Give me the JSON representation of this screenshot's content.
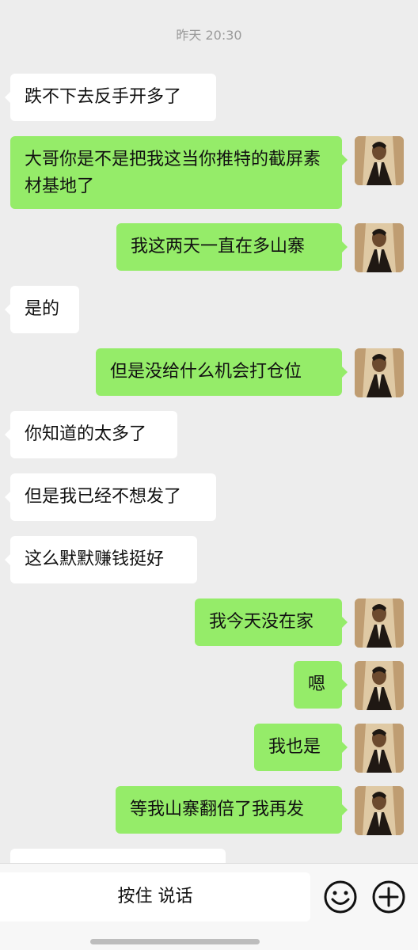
{
  "chat": {
    "timestamp": "昨天 20:30",
    "messages": [
      {
        "side": "left",
        "text": "跌不下去反手开多了"
      },
      {
        "side": "right",
        "text": "大哥你是不是把我这当你推特的截屏素材基地了"
      },
      {
        "side": "right",
        "text": "我这两天一直在多山寨"
      },
      {
        "side": "left",
        "text": "是的"
      },
      {
        "side": "right",
        "text": "但是没给什么机会打仓位"
      },
      {
        "side": "left",
        "text": "你知道的太多了"
      },
      {
        "side": "left",
        "text": "但是我已经不想发了"
      },
      {
        "side": "left",
        "text": "这么默默赚钱挺好"
      },
      {
        "side": "right",
        "text": "我今天没在家"
      },
      {
        "side": "right",
        "text": "嗯"
      },
      {
        "side": "right",
        "text": "我也是"
      },
      {
        "side": "right",
        "text": "等我山寨翻倍了我再发"
      }
    ]
  },
  "input_bar": {
    "voice_label": "按住 说话",
    "emoji_icon": "smiley-face-icon",
    "plus_icon": "plus-circle-icon"
  },
  "colors": {
    "background": "#ededed",
    "incoming_bubble": "#ffffff",
    "outgoing_bubble": "#95ec69"
  }
}
